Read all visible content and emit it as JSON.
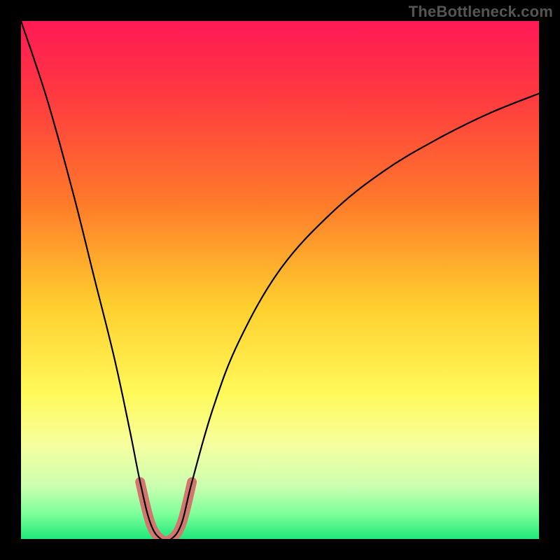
{
  "attribution": "TheBottleneck.com",
  "chart_data": {
    "type": "line",
    "title": "",
    "xlabel": "",
    "ylabel": "",
    "ylim": [
      0,
      100
    ],
    "xlim": [
      0,
      100
    ],
    "series": [
      {
        "name": "bottleneck-curve",
        "x": [
          0,
          5,
          10,
          14,
          18,
          21,
          23,
          25,
          27,
          29,
          31,
          33,
          37,
          42,
          50,
          60,
          70,
          80,
          90,
          100
        ],
        "y": [
          100,
          85,
          67,
          51,
          35,
          21,
          11,
          3,
          0,
          0,
          3,
          11,
          25,
          38,
          52,
          63,
          71,
          77,
          82,
          86
        ]
      }
    ],
    "highlight_region": {
      "name": "valley-highlight",
      "x": [
        23,
        25,
        27,
        29,
        31,
        33
      ],
      "y": [
        11,
        3,
        0,
        0,
        3,
        11
      ],
      "color": "#d2766e"
    },
    "gradient_stops": [
      {
        "offset": 0.0,
        "color": "#ff1a55"
      },
      {
        "offset": 0.15,
        "color": "#ff3b3f"
      },
      {
        "offset": 0.35,
        "color": "#ff7a2a"
      },
      {
        "offset": 0.55,
        "color": "#ffcf2e"
      },
      {
        "offset": 0.72,
        "color": "#fff95a"
      },
      {
        "offset": 0.82,
        "color": "#f6ffa0"
      },
      {
        "offset": 0.9,
        "color": "#c9ffb0"
      },
      {
        "offset": 0.95,
        "color": "#7fff9a"
      },
      {
        "offset": 1.0,
        "color": "#20e87a"
      }
    ],
    "curve_stroke": "#000000",
    "curve_width": 2.2,
    "highlight_width": 14
  }
}
